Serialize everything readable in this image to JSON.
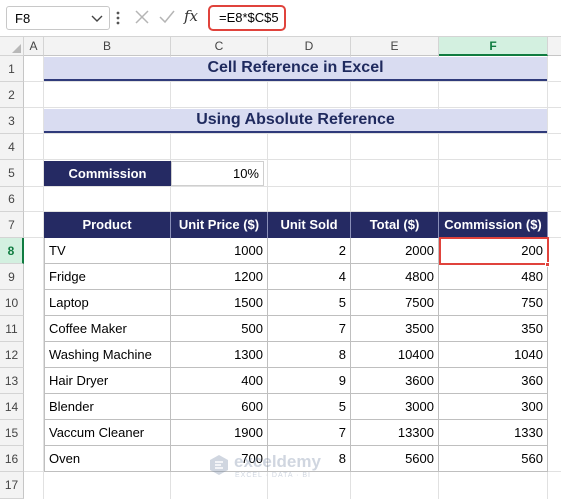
{
  "formula_bar": {
    "name_box": "F8",
    "fx_label": "fx",
    "formula": "=E8*$C$5"
  },
  "columns": [
    "A",
    "B",
    "C",
    "D",
    "E",
    "F"
  ],
  "rows": [
    "1",
    "2",
    "3",
    "4",
    "5",
    "6",
    "7",
    "8",
    "9",
    "10",
    "11",
    "12",
    "13",
    "14",
    "15",
    "16",
    "17"
  ],
  "selected": {
    "column": "F",
    "row": "8"
  },
  "sheet": {
    "title": "Cell Reference in Excel",
    "subtitle": "Using Absolute Reference",
    "commission_label": "Commission",
    "commission_value": "10%",
    "table": {
      "headers": [
        "Product",
        "Unit Price ($)",
        "Unit Sold",
        "Total ($)",
        "Commission ($)"
      ],
      "rows": [
        [
          "TV",
          "1000",
          "2",
          "2000",
          "200"
        ],
        [
          "Fridge",
          "1200",
          "4",
          "4800",
          "480"
        ],
        [
          "Laptop",
          "1500",
          "5",
          "7500",
          "750"
        ],
        [
          "Coffee Maker",
          "500",
          "7",
          "3500",
          "350"
        ],
        [
          "Washing Machine",
          "1300",
          "8",
          "10400",
          "1040"
        ],
        [
          "Hair Dryer",
          "400",
          "9",
          "3600",
          "360"
        ],
        [
          "Blender",
          "600",
          "5",
          "3000",
          "300"
        ],
        [
          "Vaccum Cleaner",
          "1900",
          "7",
          "13300",
          "1330"
        ],
        [
          "Oven",
          "700",
          "8",
          "5600",
          "560"
        ]
      ]
    }
  },
  "watermark": {
    "name": "exceldemy",
    "tagline": "EXCEL · DATA · BI"
  },
  "colors": {
    "header_fill": "#252a63",
    "title_fill": "#d9dcf1",
    "accent_red": "#e0433c",
    "excel_green": "#107c41"
  }
}
